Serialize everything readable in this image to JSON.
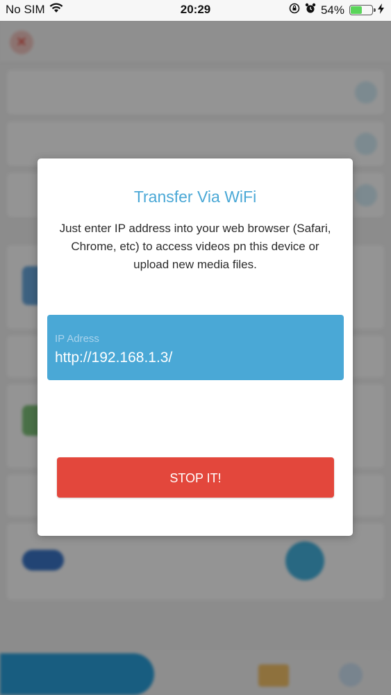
{
  "status_bar": {
    "carrier": "No SIM",
    "time": "20:29",
    "battery_percent": "54%",
    "battery_level": 0.54,
    "icons": [
      "wifi-icon",
      "orientation-lock-icon",
      "alarm-icon",
      "battery-icon",
      "charging-icon"
    ]
  },
  "dialog": {
    "title": "Transfer Via WiFi",
    "description": "Just enter IP address into your web browser (Safari, Chrome, etc) to access videos pn this device or upload new media files.",
    "ip_label": "IP Adress",
    "ip_value": "http://192.168.1.3/",
    "stop_label": "STOP IT!"
  },
  "colors": {
    "accent": "#4aa8d6",
    "stop_button": "#e3473c",
    "title": "#4aa8d6"
  }
}
